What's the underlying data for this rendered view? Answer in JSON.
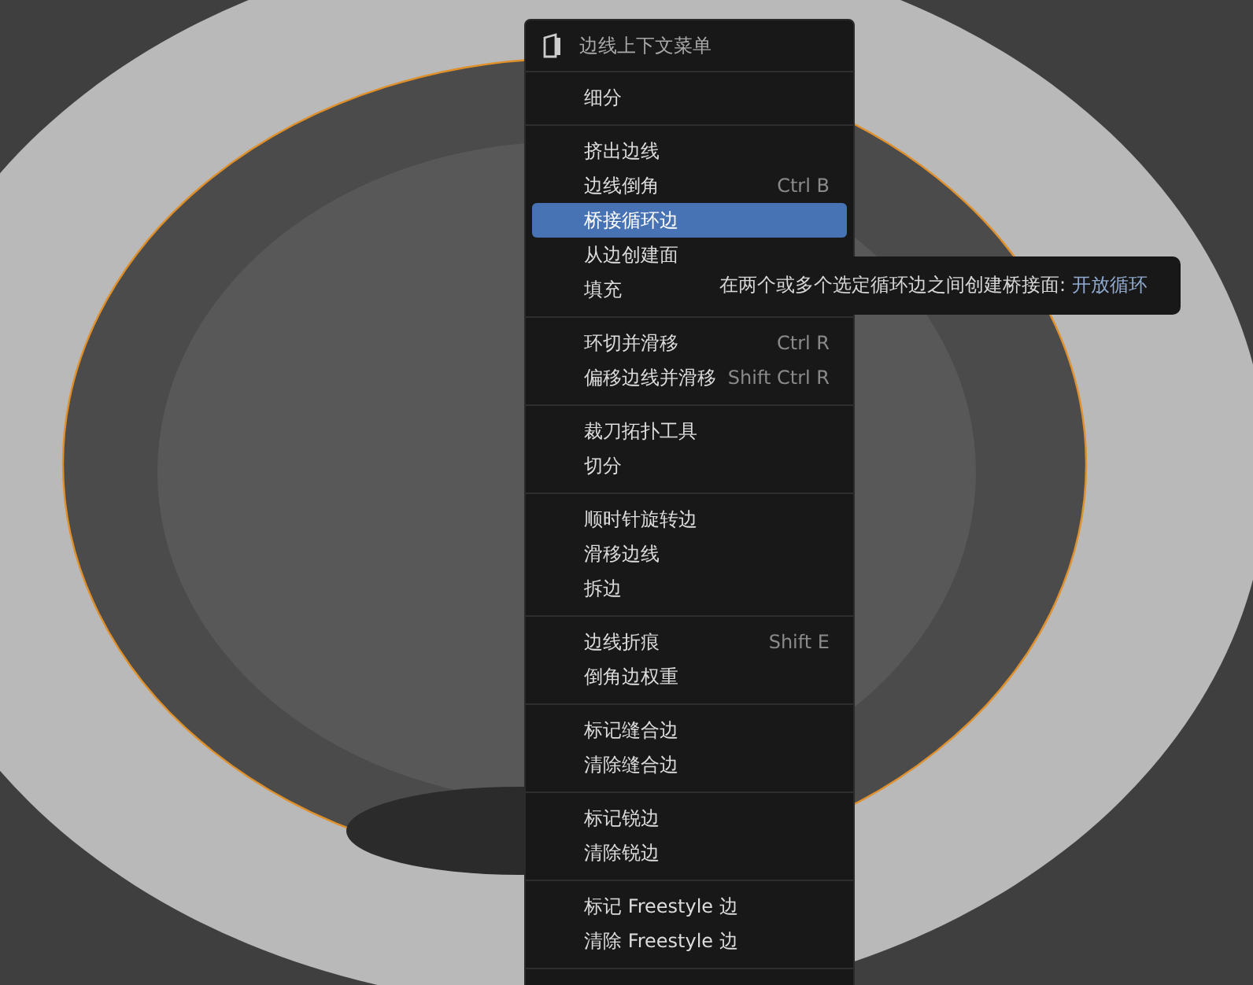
{
  "menu": {
    "title": "边线上下文菜单",
    "groups": [
      [
        {
          "label": "细分",
          "selected": false
        }
      ],
      [
        {
          "label": "挤出边线",
          "selected": false
        },
        {
          "label": "边线倒角",
          "shortcut": "Ctrl B",
          "selected": false
        },
        {
          "label": "桥接循环边",
          "selected": true
        },
        {
          "label": "从边创建面",
          "selected": false
        },
        {
          "label": "填充",
          "selected": false
        }
      ],
      [
        {
          "label": "环切并滑移",
          "shortcut": "Ctrl R",
          "selected": false
        },
        {
          "label": "偏移边线并滑移",
          "shortcut": "Shift Ctrl R",
          "selected": false
        }
      ],
      [
        {
          "label": "裁刀拓扑工具",
          "selected": false
        },
        {
          "label": "切分",
          "selected": false
        }
      ],
      [
        {
          "label": "顺时针旋转边",
          "selected": false
        },
        {
          "label": "滑移边线",
          "selected": false
        },
        {
          "label": "拆边",
          "selected": false
        }
      ],
      [
        {
          "label": "边线折痕",
          "shortcut": "Shift E",
          "selected": false
        },
        {
          "label": "倒角边权重",
          "selected": false
        }
      ],
      [
        {
          "label": "标记缝合边",
          "selected": false
        },
        {
          "label": "清除缝合边",
          "selected": false
        }
      ],
      [
        {
          "label": "标记锐边",
          "selected": false
        },
        {
          "label": "清除锐边",
          "selected": false
        }
      ],
      [
        {
          "label": "标记 Freestyle 边",
          "selected": false
        },
        {
          "label": "清除 Freestyle 边",
          "selected": false
        }
      ]
    ]
  },
  "tooltip": {
    "text": "在两个或多个选定循环边之间创建桥接面:",
    "highlight": "开放循环"
  }
}
